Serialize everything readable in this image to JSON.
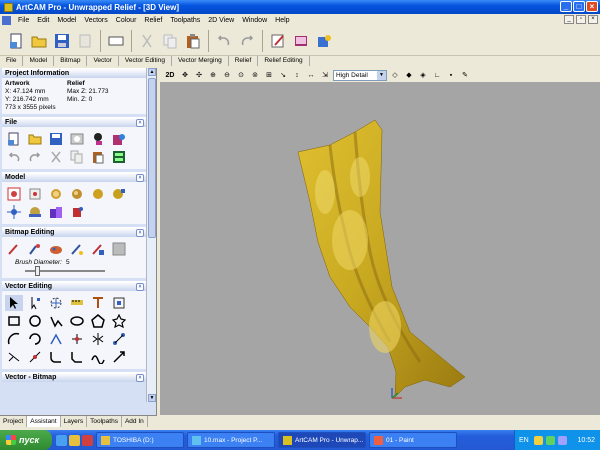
{
  "window": {
    "title": "ArtCAM Pro - Unwrapped Relief - [3D View]"
  },
  "menu": {
    "items": [
      "File",
      "Edit",
      "Model",
      "Vectors",
      "Colour",
      "Relief",
      "Toolpaths",
      "2D View",
      "Window",
      "Help"
    ]
  },
  "toolbar_tabs": [
    "File",
    "Model",
    "Bitmap",
    "Vector",
    "Vector Editing",
    "Vector Merging",
    "Relief",
    "Relief Editing"
  ],
  "project_info": {
    "header": "Project Information",
    "artwork_label": "Artwork",
    "relief_label": "Relief",
    "x": "X: 47.124 mm",
    "y": "Y: 216.742 mm",
    "pixels": "773 x 3555 pixels",
    "max_z": "Max Z: 21.773",
    "min_z": "Min. Z: 0"
  },
  "sections": {
    "file": "File",
    "model": "Model",
    "bitmap_editing": "Bitmap Editing",
    "vector_editing": "Vector Editing",
    "vector_bitmap": "Vector - Bitmap"
  },
  "brush": {
    "label": "Brush Diameter:",
    "value": "5",
    "level": 0.13
  },
  "bottom_tabs": [
    "Project",
    "Assistant",
    "Layers",
    "Toolpaths",
    "Add In"
  ],
  "view_toolbar": {
    "mode_2d": "2D",
    "detail_select": "High Detail"
  },
  "taskbar": {
    "start": "пуск",
    "tasks": [
      "TOSHIBA (D:)",
      "10.max - Project P...",
      "ArtCAM Pro - Unwrap...",
      "01 - Paint"
    ],
    "language": "EN",
    "clock": "10:52"
  },
  "colors": {
    "viewport_bg": "#a5a5a5",
    "relief": "#c8a820",
    "panel_bg": "#d6e0f4",
    "title_bar": "#0454e0"
  }
}
